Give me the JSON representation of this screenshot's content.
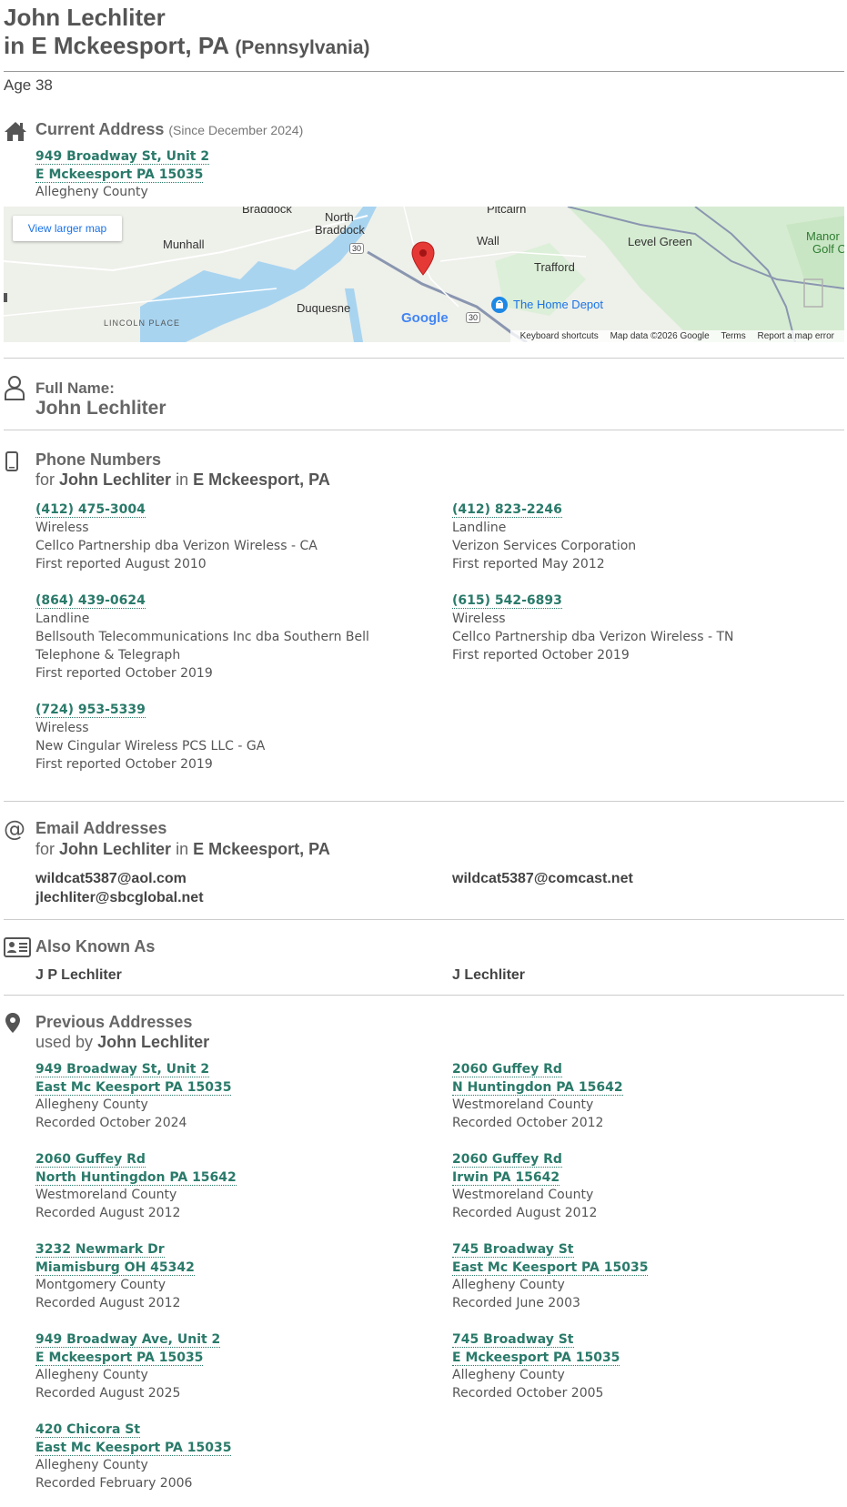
{
  "person": {
    "name": "John Lechliter",
    "location": "in E Mckeesport, PA",
    "state_full": "(Pennsylvania)",
    "age": "Age 38"
  },
  "current_address": {
    "title": "Current Address",
    "since": "(Since December 2024)",
    "line1": "949 Broadway St, Unit 2",
    "line2": "E Mckeesport PA 15035",
    "county": "Allegheny County"
  },
  "map": {
    "view_larger": "View larger map",
    "labels": {
      "braddock": "Braddock",
      "north_braddock_1": "North",
      "north_braddock_2": "Braddock",
      "pitcairn": "Pitcairn",
      "munhall": "Munhall",
      "wall": "Wall",
      "level_green": "Level Green",
      "manor_1": "Manor",
      "manor_2": "Golf C",
      "trafford": "Trafford",
      "duquesne": "Duquesne",
      "lincoln_place": "LINCOLN PLACE",
      "home_depot": "The Home Depot",
      "route1": "30",
      "route2": "30"
    },
    "google": "Google",
    "footer": {
      "shortcuts": "Keyboard shortcuts",
      "data": "Map data ©2026 Google",
      "terms": "Terms",
      "report": "Report a map error"
    }
  },
  "full_name": {
    "label": "Full Name:",
    "value": "John Lechliter"
  },
  "phones": {
    "title": "Phone Numbers",
    "sub_for": "for",
    "sub_name": "John Lechliter",
    "sub_in": "in",
    "sub_loc": "E Mckeesport, PA",
    "items": [
      {
        "number": "(412) 475-3004",
        "type": "Wireless",
        "carrier": "Cellco Partnership dba Verizon Wireless - CA",
        "reported": "First reported August 2010"
      },
      {
        "number": "(412) 823-2246",
        "type": "Landline",
        "carrier": "Verizon Services Corporation",
        "reported": "First reported May 2012"
      },
      {
        "number": "(864) 439-0624",
        "type": "Landline",
        "carrier": "Bellsouth Telecommunications Inc dba Southern Bell Telephone & Telegraph",
        "reported": "First reported October 2019"
      },
      {
        "number": "(615) 542-6893",
        "type": "Wireless",
        "carrier": "Cellco Partnership dba Verizon Wireless - TN",
        "reported": "First reported October 2019"
      },
      {
        "number": "(724) 953-5339",
        "type": "Wireless",
        "carrier": "New Cingular Wireless PCS LLC - GA",
        "reported": "First reported October 2019"
      }
    ]
  },
  "emails": {
    "title": "Email Addresses",
    "sub_for": "for",
    "sub_name": "John Lechliter",
    "sub_in": "in",
    "sub_loc": "E Mckeesport, PA",
    "items": [
      "wildcat5387@aol.com",
      "wildcat5387@comcast.net",
      "jlechliter@sbcglobal.net"
    ]
  },
  "aka": {
    "title": "Also Known As",
    "items": [
      "J P Lechliter",
      "J Lechliter"
    ]
  },
  "previous": {
    "title": "Previous Addresses",
    "sub_used": "used by",
    "sub_name": "John Lechliter",
    "items": [
      {
        "line1": "949 Broadway St, Unit 2",
        "line2": "East Mc Keesport PA 15035",
        "county": "Allegheny County",
        "recorded": "Recorded October 2024"
      },
      {
        "line1": "2060 Guffey Rd",
        "line2": "N Huntingdon PA 15642",
        "county": "Westmoreland County",
        "recorded": "Recorded October 2012"
      },
      {
        "line1": "2060 Guffey Rd",
        "line2": "North Huntingdon PA 15642",
        "county": "Westmoreland County",
        "recorded": "Recorded August 2012"
      },
      {
        "line1": "2060 Guffey Rd",
        "line2": "Irwin PA 15642",
        "county": "Westmoreland County",
        "recorded": "Recorded August 2012"
      },
      {
        "line1": "3232 Newmark Dr",
        "line2": "Miamisburg OH 45342",
        "county": "Montgomery County",
        "recorded": "Recorded August 2012"
      },
      {
        "line1": "745 Broadway St",
        "line2": "East Mc Keesport PA 15035",
        "county": "Allegheny County",
        "recorded": "Recorded June 2003"
      },
      {
        "line1": "949 Broadway Ave, Unit 2",
        "line2": "E Mckeesport PA 15035",
        "county": "Allegheny County",
        "recorded": "Recorded August 2025"
      },
      {
        "line1": "745 Broadway St",
        "line2": "E Mckeesport PA 15035",
        "county": "Allegheny County",
        "recorded": "Recorded October 2005"
      },
      {
        "line1": "420 Chicora St",
        "line2": "East Mc Keesport PA 15035",
        "county": "Allegheny County",
        "recorded": "Recorded February 2006"
      }
    ]
  },
  "colors": {
    "link": "#2a7a6a",
    "heading": "#666666",
    "map_pin": "#e53935"
  }
}
